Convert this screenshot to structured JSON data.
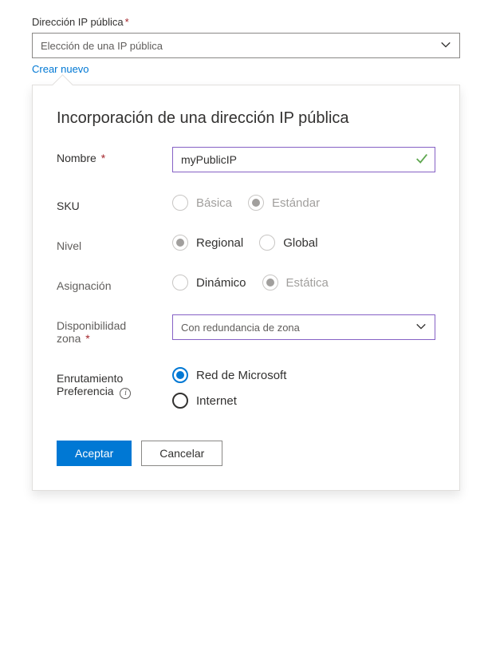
{
  "main": {
    "field_label": "Dirección IP pública",
    "select_placeholder": "Elección de una IP pública",
    "create_new_link": "Crear nuevo"
  },
  "popover": {
    "title": "Incorporación de una dirección IP pública",
    "name": {
      "label": "Nombre",
      "value": "myPublicIP"
    },
    "sku": {
      "label": "SKU",
      "options": {
        "basic": "Básica",
        "standard": "Estándar"
      },
      "selected": "standard"
    },
    "tier": {
      "label": "Nivel",
      "options": {
        "regional": "Regional",
        "global": "Global"
      },
      "selected": "regional"
    },
    "assignment": {
      "label": "Asignación",
      "options": {
        "dynamic": "Dinámico",
        "static": "Estática"
      },
      "selected": "static"
    },
    "availability": {
      "label_line1": "Disponibilidad",
      "label_line2": "zona",
      "value": "Con redundancia de zona"
    },
    "routing": {
      "label_line1": "Enrutamiento",
      "label_line2": "Preferencia",
      "options": {
        "microsoft": "Red de Microsoft",
        "internet": "Internet"
      },
      "selected": "microsoft"
    },
    "buttons": {
      "ok": "Aceptar",
      "cancel": "Cancelar"
    }
  }
}
